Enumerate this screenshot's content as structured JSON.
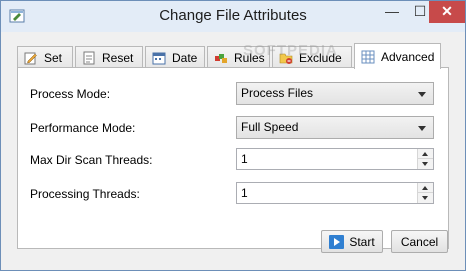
{
  "window": {
    "title": "Change File Attributes",
    "controls": {
      "minimize": "—",
      "maximize": "☐",
      "close": "✕"
    }
  },
  "tabs": [
    {
      "label": "Set",
      "icon": "pencil-icon"
    },
    {
      "label": "Reset",
      "icon": "document-icon"
    },
    {
      "label": "Date",
      "icon": "calendar-icon"
    },
    {
      "label": "Rules",
      "icon": "rules-icon"
    },
    {
      "label": "Exclude",
      "icon": "exclude-folder-icon"
    },
    {
      "label": "Advanced",
      "icon": "advanced-grid-icon",
      "active": true
    }
  ],
  "advanced": {
    "process_mode": {
      "label": "Process Mode:",
      "value": "Process Files"
    },
    "performance_mode": {
      "label": "Performance Mode:",
      "value": "Full Speed"
    },
    "max_dir_scan_threads": {
      "label": "Max Dir Scan Threads:",
      "value": "1"
    },
    "processing_threads": {
      "label": "Processing Threads:",
      "value": "1"
    }
  },
  "buttons": {
    "start": "Start",
    "cancel": "Cancel"
  },
  "watermark": "SOFTPEDIA",
  "colors": {
    "accent": "#2f7fd1",
    "close": "#c74a4a"
  }
}
